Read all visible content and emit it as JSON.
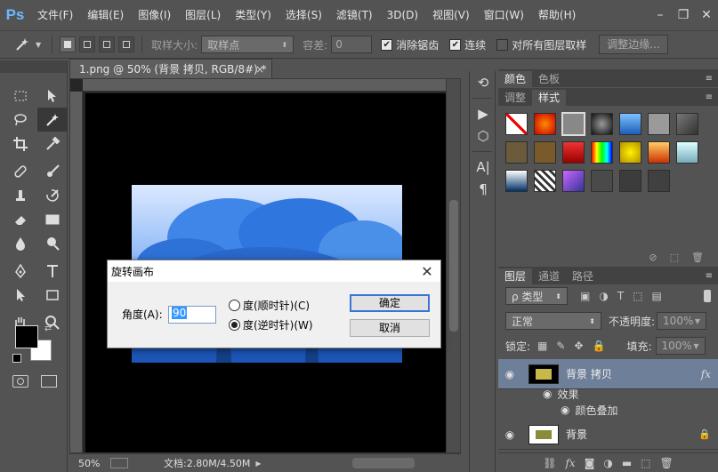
{
  "app": {
    "logo": "Ps"
  },
  "menu": [
    "文件(F)",
    "编辑(E)",
    "图像(I)",
    "图层(L)",
    "类型(Y)",
    "选择(S)",
    "滤镜(T)",
    "3D(D)",
    "视图(V)",
    "窗口(W)",
    "帮助(H)"
  ],
  "options": {
    "sample_size_label": "取样大小:",
    "sample_size_value": "取样点",
    "tolerance_label": "容差:",
    "tolerance_value": "0",
    "antialias": "消除锯齿",
    "contiguous": "连续",
    "all_layers": "对所有图层取样",
    "refine_edge": "调整边缘..."
  },
  "document": {
    "tab_title": "1.png @ 50% (背景 拷贝, RGB/8#) *",
    "zoom": "50%",
    "doc_info": "文档:2.80M/4.50M"
  },
  "panels": {
    "top_tabs": [
      "颜色",
      "色板"
    ],
    "second_tabs": [
      "调整",
      "样式"
    ],
    "layers_tabs": [
      "图层",
      "通道",
      "路径"
    ],
    "filter_kind": "ρ 类型",
    "blend_mode": "正常",
    "opacity_label": "不透明度:",
    "opacity_value": "100%",
    "lock_label": "锁定:",
    "fill_label": "填充:",
    "fill_value": "100%",
    "layers": [
      {
        "name": "背景 拷贝",
        "fx": "fx"
      },
      {
        "name": "背景"
      }
    ],
    "effects_label": "效果",
    "effect_item": "颜色叠加"
  },
  "dialog": {
    "title": "旋转画布",
    "angle_label": "角度(A):",
    "angle_value": "90",
    "cw_label": "度(顺时针)(C)",
    "ccw_label": "度(逆时针)(W)",
    "ok": "确定",
    "cancel": "取消"
  },
  "colors": {
    "accent": "#3a75d1",
    "selected_layer": "#6e7f99",
    "image_blue": "#2b6fd6"
  }
}
